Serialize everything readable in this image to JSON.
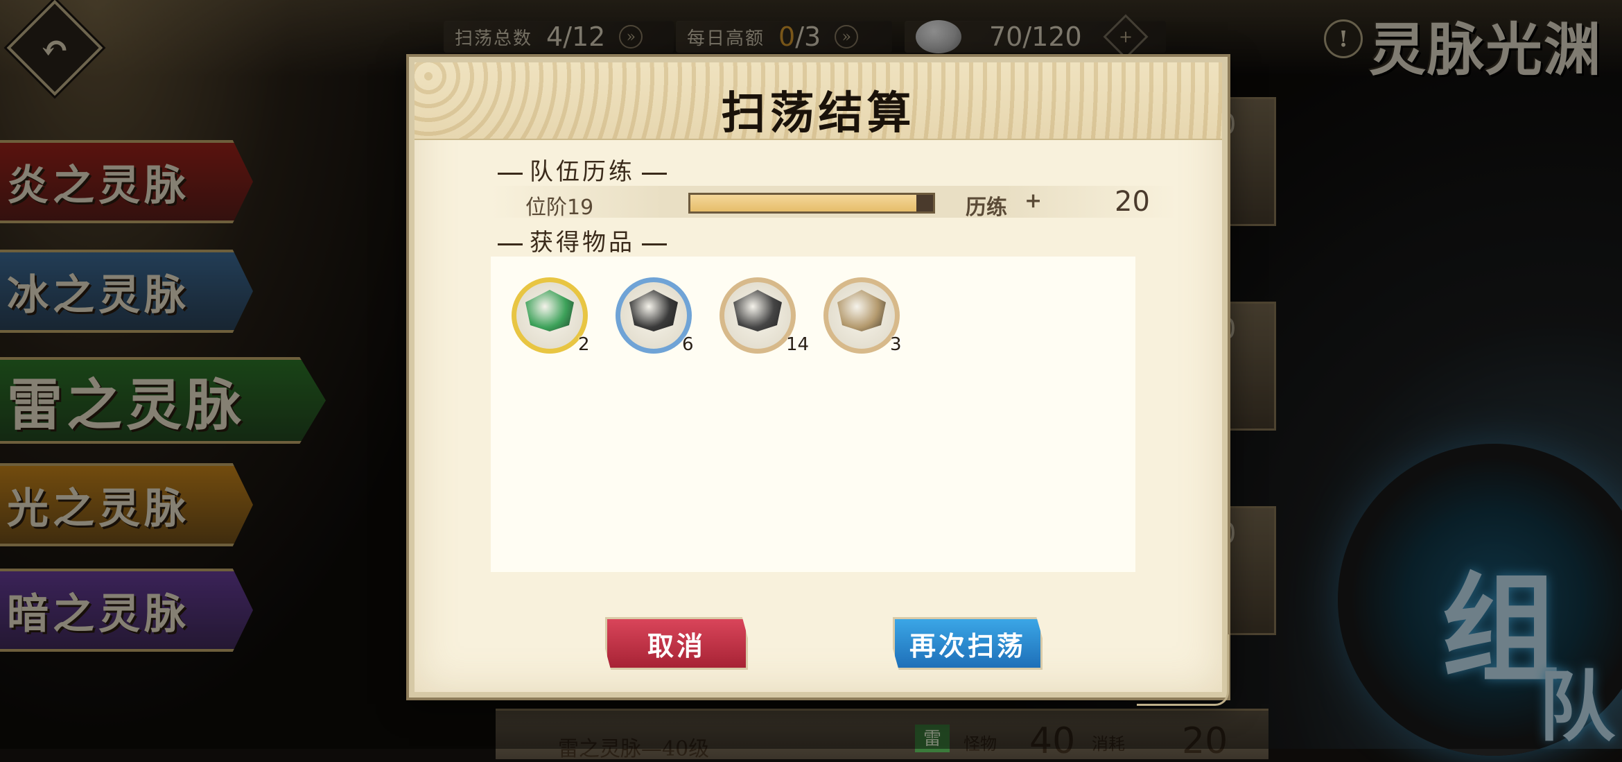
{
  "topbar": {
    "sweep_total_label": "扫荡总数",
    "sweep_total_value": "4/12",
    "daily_label": "每日高额",
    "daily_value_current": "0",
    "daily_value_rest": "/3",
    "stamina_value": "70/120",
    "stamina_icon": "stone-icon",
    "add_icon": "plus-icon"
  },
  "logo": "灵脉光渊",
  "veins": [
    {
      "label": "炎之灵脉",
      "color": "#a3231b",
      "active": false
    },
    {
      "label": "冰之灵脉",
      "color": "#3f6f9c",
      "active": false
    },
    {
      "label": "雷之灵脉",
      "color": "#2f7b2a",
      "active": true
    },
    {
      "label": "光之灵脉",
      "color": "#d08a1a",
      "active": false
    },
    {
      "label": "暗之灵脉",
      "color": "#6b3fa0",
      "active": false
    }
  ],
  "bg_cards": [
    "0",
    "0",
    "0"
  ],
  "team_button": {
    "line1": "组",
    "line2": "队"
  },
  "bottom_row": {
    "name": "雷之灵脉—40级",
    "badge": "雷",
    "monster_label": "怪物",
    "monster_value": "40",
    "cost_label": "消耗",
    "cost_value": "20"
  },
  "dialog": {
    "title": "扫荡结算",
    "team_training_title": "队伍历练",
    "rank_label": "位阶19",
    "rank_progress": 0.93,
    "training_label": "历练",
    "training_plus": "+",
    "training_value": "20",
    "items_title": "获得物品",
    "items": [
      {
        "count": "2",
        "ring": "#e8c542",
        "gem": "#3da25a"
      },
      {
        "count": "6",
        "ring": "#6fa3d6",
        "gem": "#3a3a3a"
      },
      {
        "count": "14",
        "ring": "#d7b98a",
        "gem": "#454545"
      },
      {
        "count": "3",
        "ring": "#d7b98a",
        "gem": "#b49a6e"
      }
    ],
    "cancel_label": "取消",
    "again_label": "再次扫荡"
  },
  "colors": {
    "cancel": "#c2334a",
    "again": "#2f8ad2",
    "highlight": "#e0a030"
  }
}
